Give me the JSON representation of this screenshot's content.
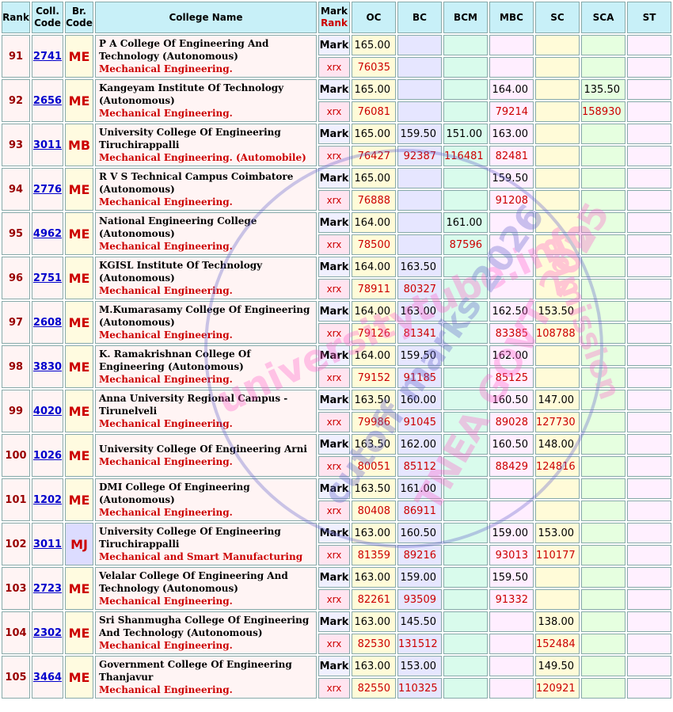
{
  "headers": {
    "rank": "Rank",
    "coll_code_1": "Coll.",
    "coll_code_2": "Code",
    "br_code_1": "Br.",
    "br_code_2": "Code",
    "name": "College Name",
    "mark": "Mark",
    "mark_rank": "Rank",
    "oc": "OC",
    "bc": "BC",
    "bcm": "BCM",
    "mbc": "MBC",
    "sc": "SC",
    "sca": "SCA",
    "st": "ST"
  },
  "labels": {
    "mark": "Mark",
    "rank": "xrx"
  },
  "rows": [
    {
      "rank": "91",
      "code": "2741",
      "br": "ME",
      "name": "P A College Of Engineering And Technology (Autonomous)",
      "branch": "Mechanical Engineering.",
      "marks": [
        "165.00",
        "",
        "",
        "",
        "",
        "",
        ""
      ],
      "ranks": [
        "76035",
        "",
        "",
        "",
        "",
        "",
        ""
      ]
    },
    {
      "rank": "92",
      "code": "2656",
      "br": "ME",
      "name": "Kangeyam Institute Of Technology (Autonomous)",
      "branch": "Mechanical Engineering.",
      "marks": [
        "165.00",
        "",
        "",
        "164.00",
        "",
        "135.50",
        ""
      ],
      "ranks": [
        "76081",
        "",
        "",
        "79214",
        "",
        "158930",
        ""
      ]
    },
    {
      "rank": "93",
      "code": "3011",
      "br": "MB",
      "name": "University College Of Engineering Tiruchirappalli",
      "branch": "Mechanical Engineering. (Automobile)",
      "marks": [
        "165.00",
        "159.50",
        "151.00",
        "163.00",
        "",
        "",
        ""
      ],
      "ranks": [
        "76427",
        "92387",
        "116481",
        "82481",
        "",
        "",
        ""
      ]
    },
    {
      "rank": "94",
      "code": "2776",
      "br": "ME",
      "name": "R V S Technical Campus Coimbatore (Autonomous)",
      "branch": "Mechanical Engineering.",
      "marks": [
        "165.00",
        "",
        "",
        "159.50",
        "",
        "",
        ""
      ],
      "ranks": [
        "76888",
        "",
        "",
        "91208",
        "",
        "",
        ""
      ]
    },
    {
      "rank": "95",
      "code": "4962",
      "br": "ME",
      "name": "National Engineering College (Autonomous)",
      "branch": "Mechanical Engineering.",
      "marks": [
        "164.00",
        "",
        "161.00",
        "",
        "",
        "",
        ""
      ],
      "ranks": [
        "78500",
        "",
        "87596",
        "",
        "",
        "",
        ""
      ]
    },
    {
      "rank": "96",
      "code": "2751",
      "br": "ME",
      "name": "KGISL Institute Of Technology (Autonomous)",
      "branch": "Mechanical Engineering.",
      "marks": [
        "164.00",
        "163.50",
        "",
        "",
        "",
        "",
        ""
      ],
      "ranks": [
        "78911",
        "80327",
        "",
        "",
        "",
        "",
        ""
      ]
    },
    {
      "rank": "97",
      "code": "2608",
      "br": "ME",
      "name": "M.Kumarasamy College Of Engineering (Autonomous)",
      "branch": "Mechanical Engineering.",
      "marks": [
        "164.00",
        "163.00",
        "",
        "162.50",
        "153.50",
        "",
        ""
      ],
      "ranks": [
        "79126",
        "81341",
        "",
        "83385",
        "108788",
        "",
        ""
      ]
    },
    {
      "rank": "98",
      "code": "3830",
      "br": "ME",
      "name": "K. Ramakrishnan College Of Engineering (Autonomous)",
      "branch": "Mechanical Engineering.",
      "marks": [
        "164.00",
        "159.50",
        "",
        "162.00",
        "",
        "",
        ""
      ],
      "ranks": [
        "79152",
        "91185",
        "",
        "85125",
        "",
        "",
        ""
      ]
    },
    {
      "rank": "99",
      "code": "4020",
      "br": "ME",
      "name": "Anna University Regional Campus - Tirunelveli",
      "branch": "Mechanical Engineering.",
      "marks": [
        "163.50",
        "160.00",
        "",
        "160.50",
        "147.00",
        "",
        ""
      ],
      "ranks": [
        "79986",
        "91045",
        "",
        "89028",
        "127730",
        "",
        ""
      ]
    },
    {
      "rank": "100",
      "code": "1026",
      "br": "ME",
      "name": "University College Of Engineering Arni",
      "branch": "Mechanical Engineering.",
      "marks": [
        "163.50",
        "162.00",
        "",
        "160.50",
        "148.00",
        "",
        ""
      ],
      "ranks": [
        "80051",
        "85112",
        "",
        "88429",
        "124816",
        "",
        ""
      ]
    },
    {
      "rank": "101",
      "code": "1202",
      "br": "ME",
      "name": "DMI College Of Engineering (Autonomous)",
      "branch": "Mechanical Engineering.",
      "marks": [
        "163.50",
        "161.00",
        "",
        "",
        "",
        "",
        ""
      ],
      "ranks": [
        "80408",
        "86911",
        "",
        "",
        "",
        "",
        ""
      ]
    },
    {
      "rank": "102",
      "code": "3011",
      "br": "MJ",
      "name": "University College Of Engineering Tiruchirappalli",
      "branch": "Mechanical and Smart Manufacturing",
      "marks": [
        "163.00",
        "160.50",
        "",
        "159.00",
        "153.00",
        "",
        ""
      ],
      "ranks": [
        "81359",
        "89216",
        "",
        "93013",
        "110177",
        "",
        ""
      ]
    },
    {
      "rank": "103",
      "code": "2723",
      "br": "ME",
      "name": "Velalar College Of Engineering And Technology (Autonomous)",
      "branch": "Mechanical Engineering.",
      "marks": [
        "163.00",
        "159.00",
        "",
        "159.50",
        "",
        "",
        ""
      ],
      "ranks": [
        "82261",
        "93509",
        "",
        "91332",
        "",
        "",
        ""
      ]
    },
    {
      "rank": "104",
      "code": "2302",
      "br": "ME",
      "name": "Sri Shanmugha College Of Engineering And Technology (Autonomous)",
      "branch": "Mechanical Engineering.",
      "marks": [
        "163.00",
        "145.50",
        "",
        "",
        "138.00",
        "",
        ""
      ],
      "ranks": [
        "82530",
        "131512",
        "",
        "",
        "152484",
        "",
        ""
      ]
    },
    {
      "rank": "105",
      "code": "3464",
      "br": "ME",
      "name": "Government College Of Engineering Thanjavur",
      "branch": "Mechanical Engineering.",
      "marks": [
        "163.00",
        "153.00",
        "",
        "",
        "149.50",
        "",
        ""
      ],
      "ranks": [
        "82550",
        "110325",
        "",
        "",
        "120921",
        "",
        ""
      ]
    }
  ],
  "watermark": {
    "line1": "universitytube.info",
    "line2": "cutoff marks 2026",
    "line3": "TNEA GOVT 2025",
    "line4": "admission",
    "color1": "#ff66cc",
    "color2": "#6666cc"
  }
}
